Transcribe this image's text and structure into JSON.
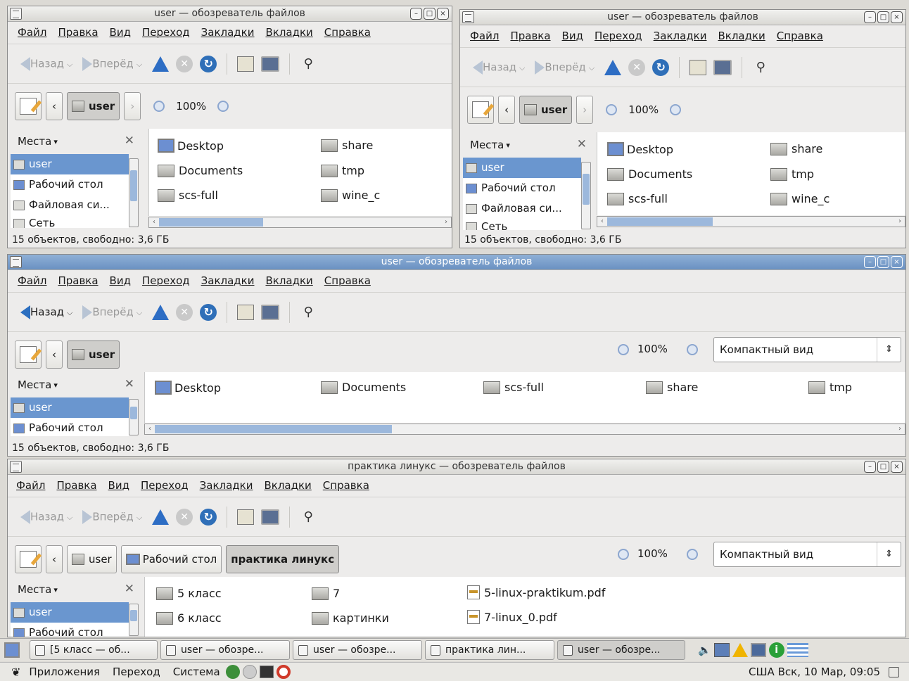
{
  "windows": [
    {
      "title": "user — обозреватель файлов"
    },
    {
      "title": "user — обозреватель файлов"
    },
    {
      "title": "user — обозреватель файлов"
    },
    {
      "title": "практика линукс — обозреватель файлов"
    }
  ],
  "menu": {
    "file": "Файл",
    "edit": "Правка",
    "view": "Вид",
    "go": "Переход",
    "bookmarks": "Закладки",
    "tabs": "Вкладки",
    "help": "Справка"
  },
  "toolbar": {
    "back": "Назад",
    "forward": "Вперёд"
  },
  "location": {
    "user": "user",
    "desktop": "Рабочий стол",
    "practice": "практика линукс"
  },
  "zoom": {
    "level": "100%"
  },
  "view_mode": "Компактный вид",
  "places": {
    "title": "Места",
    "items": [
      "user",
      "Рабочий стол",
      "Файловая си...",
      "Сеть"
    ]
  },
  "files_home": [
    "Desktop",
    "Documents",
    "scs-full",
    "share",
    "tmp",
    "wine_c"
  ],
  "files_practice": [
    "5 класс",
    "6 класс",
    "7",
    "картинки",
    "5-linux-praktikum.pdf",
    "7-linux_0.pdf"
  ],
  "status": "15 объектов, свободно: 3,6 ГБ",
  "taskbar": [
    "[5 класс — об...",
    "user — обозре...",
    "user — обозре...",
    "практика лин...",
    "user — обозре..."
  ],
  "panel": {
    "apps": "Приложения",
    "go": "Переход",
    "system": "Система",
    "clock": "США Вск, 10 Мар, 09:05"
  }
}
